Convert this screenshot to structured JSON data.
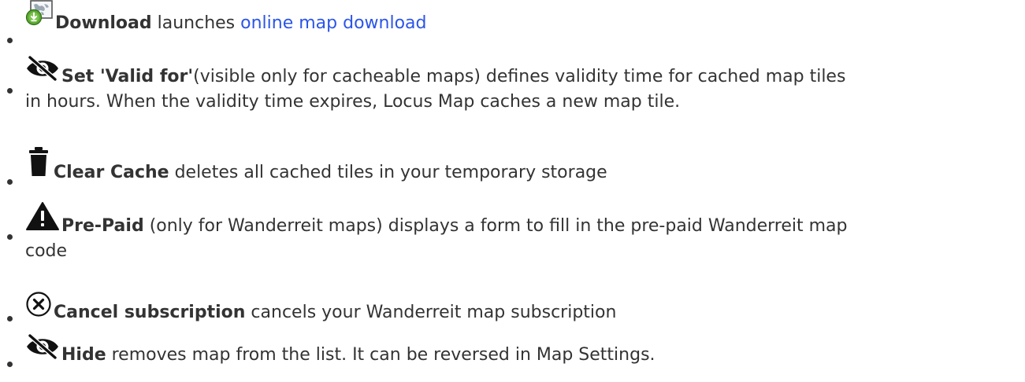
{
  "items": [
    {
      "icon": "map-download-icon",
      "label": "Download",
      "text": " launches ",
      "link": "online map download"
    },
    {
      "icon": "eye-slash-icon",
      "label": "Set 'Valid for'",
      "text": "(visible only for cacheable maps) defines validity time for cached map tiles",
      "text2": "in hours. When the validity time expires, Locus Map caches a new map tile."
    },
    {
      "icon": "trash-icon",
      "label": "Clear Cache",
      "text": " deletes all cached tiles in your temporary storage"
    },
    {
      "icon": "warning-icon",
      "label": "Pre-Paid",
      "text": " (only for Wanderreit maps) displays a form to fill in the pre-paid Wanderreit map",
      "text2": "code"
    },
    {
      "icon": "close-circle-icon",
      "label": "Cancel subscription",
      "text": " cancels your Wanderreit map subscription"
    },
    {
      "icon": "eye-slash-icon",
      "label": "Hide",
      "text": " removes map from the list. It can be reversed in Map Settings."
    }
  ],
  "colors": {
    "text": "#333333",
    "link": "#2b55e8",
    "download_icon_green": "#4a9b2a"
  }
}
